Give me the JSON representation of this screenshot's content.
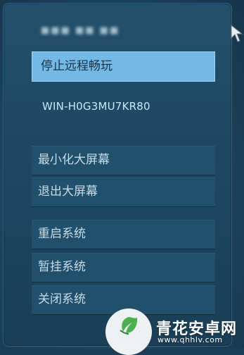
{
  "user": {
    "name_obscured": "■■■ ■■ ■■"
  },
  "stop_button": {
    "label": "停止远程畅玩"
  },
  "host": {
    "name": "WIN-H0G3MU7KR80"
  },
  "menu": {
    "items": [
      {
        "label": "最小化大屏幕"
      },
      {
        "label": "退出大屏幕"
      },
      {
        "label": "重启系统"
      },
      {
        "label": "暂挂系统"
      },
      {
        "label": "关闭系统"
      }
    ]
  },
  "watermark": {
    "title": "青花安卓网",
    "url": "www.qhhlv.com"
  },
  "colors": {
    "accent": "#74b9e6",
    "panel": "#1d4660",
    "button": "#21506d",
    "text": "#c6dbe7",
    "host_text": "#c7e8ff",
    "logo_green": "#4caf50"
  },
  "icons": {
    "cursor": "cursor-arrow-icon",
    "logo": "leaf-logo-icon"
  }
}
